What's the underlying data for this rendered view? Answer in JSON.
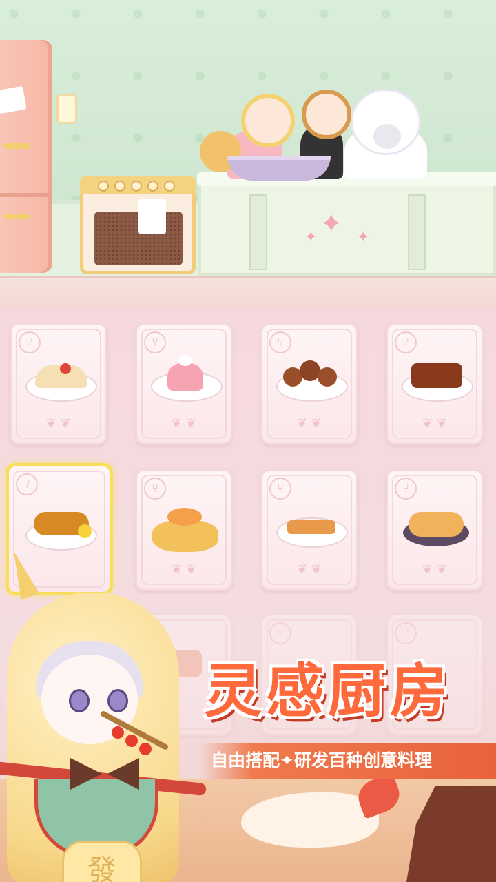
{
  "title": "灵感厨房",
  "subtitle": "自由搭配✦研发百种创意料理",
  "mascot": {
    "bag_char": "發"
  },
  "cards": [
    {
      "name": "taco",
      "selected": false
    },
    {
      "name": "strawberry-jelly",
      "selected": false
    },
    {
      "name": "meatballs",
      "selected": false
    },
    {
      "name": "braised-pork",
      "selected": false
    },
    {
      "name": "lemon-chicken",
      "selected": true
    },
    {
      "name": "fish-platter",
      "selected": false
    },
    {
      "name": "egg-toast",
      "selected": false
    },
    {
      "name": "egg-rolls",
      "selected": false
    }
  ],
  "colors": {
    "title": "#ff6a3d",
    "subtitle_bg": "#ef7a4c",
    "card_border": "#f3d8dc",
    "selected_border": "#f9dd5c"
  }
}
